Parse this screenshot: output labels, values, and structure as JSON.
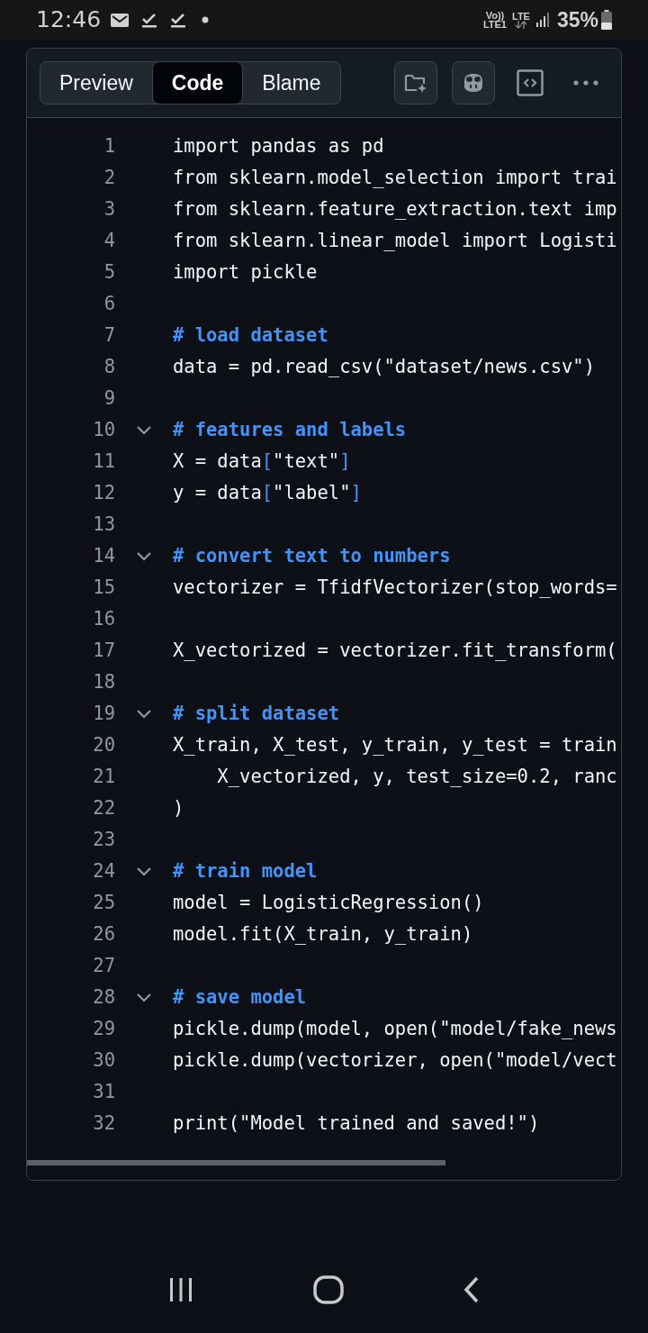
{
  "status_bar": {
    "time": "12:46",
    "volte": "Vo))",
    "lte_sim": "LTE1",
    "lte": "LTE",
    "battery": "35%"
  },
  "file_view": {
    "tabs": [
      {
        "label": "Preview",
        "selected": false
      },
      {
        "label": "Code",
        "selected": true
      },
      {
        "label": "Blame",
        "selected": false
      }
    ],
    "lines": [
      {
        "number": "1",
        "fold_toggle": false,
        "code": [
          {
            "text": "import pandas as pd",
            "kind": "plain"
          }
        ]
      },
      {
        "number": "2",
        "fold_toggle": false,
        "code": [
          {
            "text": "from sklearn.model_selection import trai",
            "kind": "plain"
          }
        ]
      },
      {
        "number": "3",
        "fold_toggle": false,
        "code": [
          {
            "text": "from sklearn.feature_extraction.text imp",
            "kind": "plain"
          }
        ]
      },
      {
        "number": "4",
        "fold_toggle": false,
        "code": [
          {
            "text": "from sklearn.linear_model import Logisti",
            "kind": "plain"
          }
        ]
      },
      {
        "number": "5",
        "fold_toggle": false,
        "code": [
          {
            "text": "import pickle",
            "kind": "plain"
          }
        ]
      },
      {
        "number": "6",
        "fold_toggle": false
      },
      {
        "number": "7",
        "fold_toggle": false,
        "code": [
          {
            "text": "# load dataset",
            "kind": "comment"
          }
        ]
      },
      {
        "number": "8",
        "fold_toggle": false,
        "code": [
          {
            "text": "data = pd.read_csv(\"dataset/news.csv\")",
            "kind": "plain"
          }
        ]
      },
      {
        "number": "9",
        "fold_toggle": false
      },
      {
        "number": "10",
        "fold_toggle": true,
        "code": [
          {
            "text": "# features and labels",
            "kind": "comment"
          }
        ]
      },
      {
        "number": "11",
        "fold_toggle": false,
        "code": [
          {
            "text": "X = data",
            "kind": "plain"
          },
          {
            "text": "[",
            "kind": "bracket"
          },
          {
            "text": "\"text\"",
            "kind": "plain"
          },
          {
            "text": "]",
            "kind": "bracket"
          }
        ]
      },
      {
        "number": "12",
        "fold_toggle": false,
        "code": [
          {
            "text": "y = data",
            "kind": "plain"
          },
          {
            "text": "[",
            "kind": "bracket"
          },
          {
            "text": "\"label\"",
            "kind": "plain"
          },
          {
            "text": "]",
            "kind": "bracket"
          }
        ]
      },
      {
        "number": "13",
        "fold_toggle": false
      },
      {
        "number": "14",
        "fold_toggle": true,
        "code": [
          {
            "text": "# convert text to numbers",
            "kind": "comment"
          }
        ]
      },
      {
        "number": "15",
        "fold_toggle": false,
        "code": [
          {
            "text": "vectorizer = TfidfVectorizer(stop_words=",
            "kind": "plain"
          }
        ]
      },
      {
        "number": "16",
        "fold_toggle": false
      },
      {
        "number": "17",
        "fold_toggle": false,
        "code": [
          {
            "text": "X_vectorized = vectorizer.fit_transform(",
            "kind": "plain"
          }
        ]
      },
      {
        "number": "18",
        "fold_toggle": false
      },
      {
        "number": "19",
        "fold_toggle": true,
        "code": [
          {
            "text": "# split dataset",
            "kind": "comment"
          }
        ]
      },
      {
        "number": "20",
        "fold_toggle": false,
        "code": [
          {
            "text": "X_train, X_test, y_train, y_test = train",
            "kind": "plain"
          }
        ]
      },
      {
        "number": "21",
        "fold_toggle": false,
        "code": [
          {
            "text": "    X_vectorized, y, test_size=0.2, ranc",
            "kind": "plain"
          }
        ]
      },
      {
        "number": "22",
        "fold_toggle": false,
        "code": [
          {
            "text": ")",
            "kind": "plain"
          }
        ]
      },
      {
        "number": "23",
        "fold_toggle": false
      },
      {
        "number": "24",
        "fold_toggle": true,
        "code": [
          {
            "text": "# train model",
            "kind": "comment"
          }
        ]
      },
      {
        "number": "25",
        "fold_toggle": false,
        "code": [
          {
            "text": "model = LogisticRegression()",
            "kind": "plain"
          }
        ]
      },
      {
        "number": "26",
        "fold_toggle": false,
        "code": [
          {
            "text": "model.fit(X_train, y_train)",
            "kind": "plain"
          }
        ]
      },
      {
        "number": "27",
        "fold_toggle": false
      },
      {
        "number": "28",
        "fold_toggle": true,
        "code": [
          {
            "text": "# save model",
            "kind": "comment"
          }
        ]
      },
      {
        "number": "29",
        "fold_toggle": false,
        "code": [
          {
            "text": "pickle.dump(model, open(\"model/fake_news",
            "kind": "plain"
          }
        ]
      },
      {
        "number": "30",
        "fold_toggle": false,
        "code": [
          {
            "text": "pickle.dump(vectorizer, open(\"model/vect",
            "kind": "plain"
          }
        ]
      },
      {
        "number": "31",
        "fold_toggle": false
      },
      {
        "number": "32",
        "fold_toggle": false,
        "code": [
          {
            "text": "print(\"Model trained and saved!\")",
            "kind": "plain"
          }
        ]
      }
    ]
  }
}
